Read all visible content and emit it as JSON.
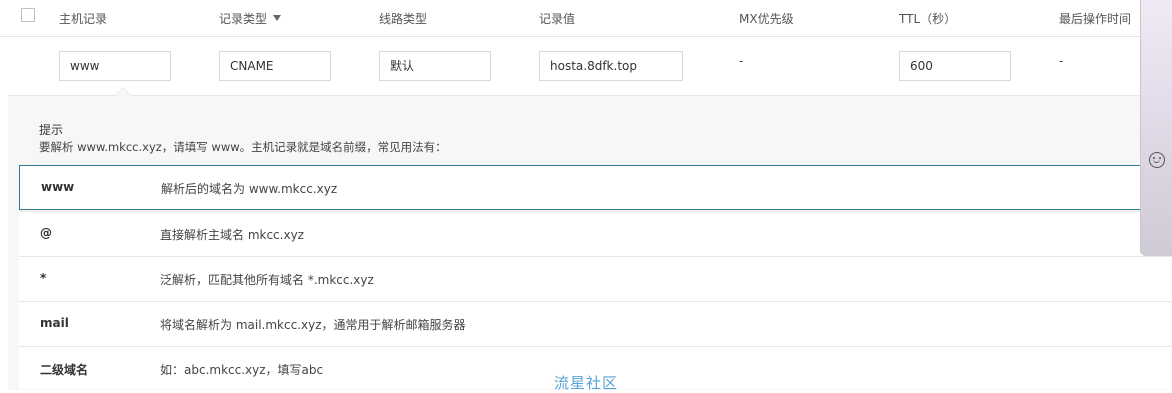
{
  "table": {
    "headers": {
      "host": "主机记录",
      "type": "记录类型",
      "line": "线路类型",
      "value": "记录值",
      "mx": "MX优先级",
      "ttl": "TTL（秒）",
      "last_op": "最后操作时间"
    },
    "edit_row": {
      "host": "www",
      "type": "CNAME",
      "line": "默认",
      "value": "hosta.8dfk.top",
      "mx": "-",
      "ttl": "600",
      "last_op": "-"
    }
  },
  "hint": {
    "title": "提示",
    "desc": "要解析 www.mkcc.xyz，请填写 www。主机记录就是域名前缀，常见用法有：",
    "rows": [
      {
        "key": "www",
        "desc": "解析后的域名为 www.mkcc.xyz"
      },
      {
        "key": "@",
        "desc": "直接解析主域名 mkcc.xyz"
      },
      {
        "key": "*",
        "desc": "泛解析，匹配其他所有域名 *.mkcc.xyz"
      },
      {
        "key": "mail",
        "desc": "将域名解析为 mail.mkcc.xyz，通常用于解析邮箱服务器"
      },
      {
        "key": "二级域名",
        "desc": "如：abc.mkcc.xyz，填写abc"
      }
    ]
  },
  "watermark": "流星社区",
  "icons": {
    "filter": "filter-icon",
    "smiley": "smiley-icon"
  },
  "colors": {
    "active_border": "#2d7a8e",
    "watermark": "#5aa3d6"
  }
}
